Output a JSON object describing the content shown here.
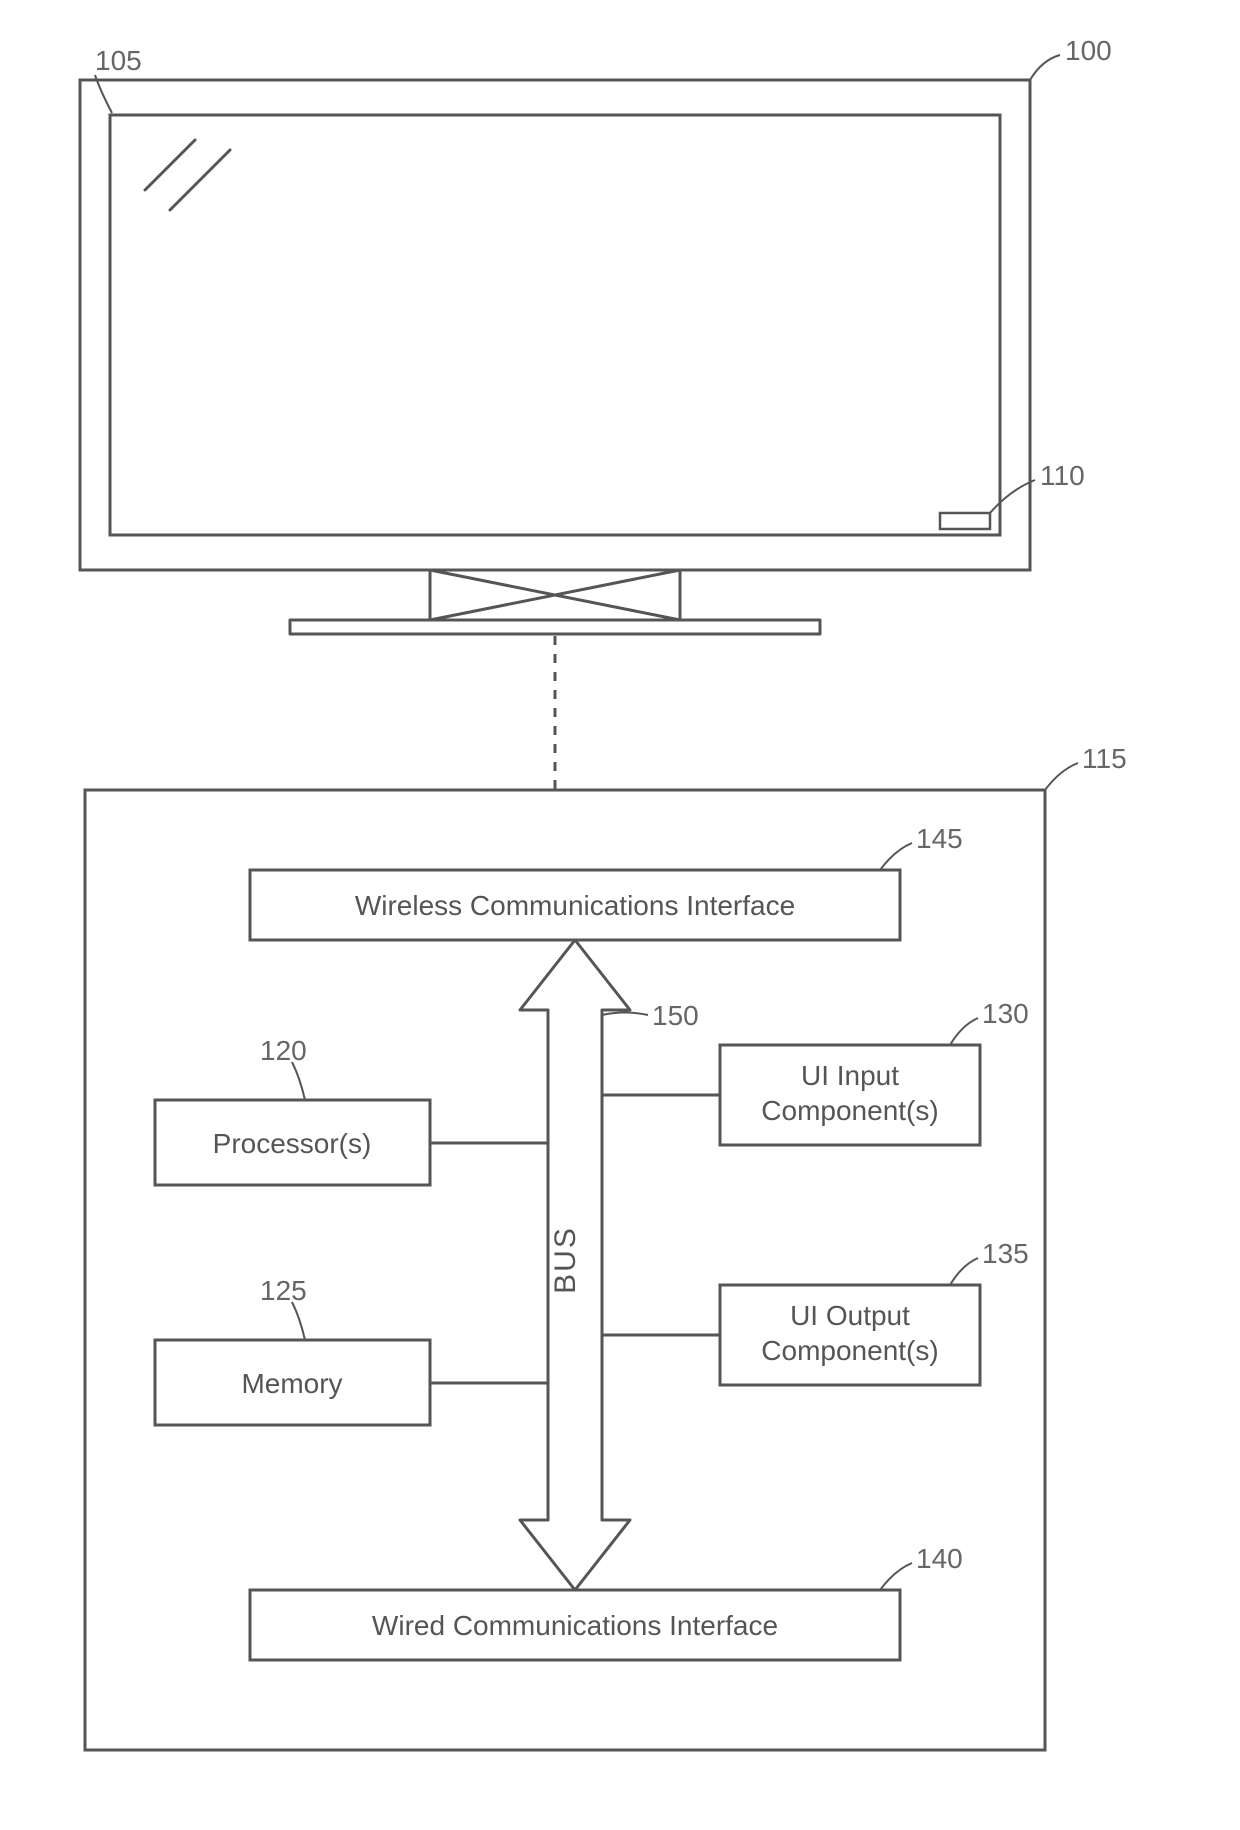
{
  "labels": {
    "n100": "100",
    "n105": "105",
    "n110": "110",
    "n115": "115",
    "n120": "120",
    "n125": "125",
    "n130": "130",
    "n135": "135",
    "n140": "140",
    "n145": "145",
    "n150": "150"
  },
  "blocks": {
    "wireless": "Wireless Communications Interface",
    "wired": "Wired Communications Interface",
    "processor": "Processor(s)",
    "memory": "Memory",
    "uiInput1": "UI Input",
    "uiInput2": "Component(s)",
    "uiOutput1": "UI Output",
    "uiOutput2": "Component(s)",
    "bus": "BUS"
  }
}
